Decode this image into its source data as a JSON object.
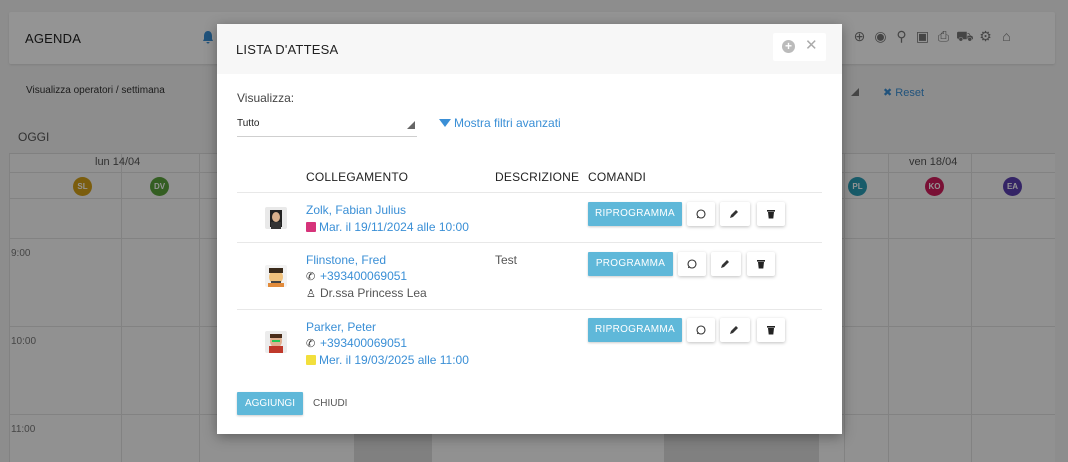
{
  "agenda": {
    "title": "AGENDA",
    "view_label": "Visualizza operatori / settimana",
    "reset_label": "Reset",
    "today_label": "OGGI",
    "days": [
      "lun 14/04",
      "ven 18/04"
    ],
    "hours": [
      "9:00",
      "10:00",
      "11:00"
    ],
    "operators_left": [
      {
        "initials": "SL",
        "color": "#d4a017"
      },
      {
        "initials": "DV",
        "color": "#5ba33c"
      }
    ],
    "operators_right": [
      {
        "initials": "PL",
        "color": "#2a9db5"
      },
      {
        "initials": "KO",
        "color": "#d11d5c"
      },
      {
        "initials": "EA",
        "color": "#5b3fb0"
      }
    ],
    "toolbar_icons": [
      "plus-circle-icon",
      "eye-icon",
      "search-icon",
      "calendar-icon",
      "print-icon",
      "car-icon",
      "gears-icon",
      "graduation-cap-icon"
    ]
  },
  "modal": {
    "title": "LISTA D'ATTESA",
    "filter": {
      "label": "Visualizza:",
      "value": "Tutto",
      "advanced_link": "Mostra filtri avanzati"
    },
    "columns": [
      "COLLEGAMENTO",
      "DESCRIZIONE",
      "COMANDI"
    ],
    "rows": [
      {
        "name": "Zolk, Fabian Julius",
        "line2_icon": "calendar-icon",
        "line2_color": "#d6337a",
        "line2": "Mar. il 19/11/2024 alle 10:00",
        "line3": "",
        "description": "",
        "action": "RIPROGRAMMA"
      },
      {
        "name": "Flinstone, Fred",
        "line2_icon": "phone-icon",
        "line2": "+393400069051",
        "line3_icon": "user-doctor-icon",
        "line3": "Dr.ssa Princess Lea",
        "description": "Test",
        "action": "PROGRAMMA"
      },
      {
        "name": "Parker, Peter",
        "line2_icon": "phone-icon",
        "line2": "+393400069051",
        "line3_icon": "calendar-icon",
        "line3_color": "#f2df3c",
        "line3": "Mer. il 19/03/2025 alle 11:00",
        "description": "",
        "action": "RIPROGRAMMA"
      }
    ],
    "add_label": "AGGIUNGI",
    "close_label": "CHIUDI"
  }
}
